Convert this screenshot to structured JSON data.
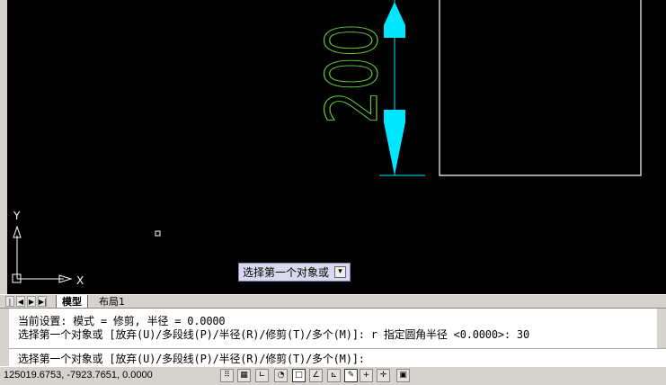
{
  "drawing": {
    "dimension_text": "200",
    "colors": {
      "dimension_text": "#66cc33",
      "arrows": "#00e6ff",
      "rectangle": "#ffffff",
      "ucs": "#ffffff"
    },
    "ucs": {
      "x_label": "X",
      "y_label": "Y"
    }
  },
  "tooltip": {
    "text": "选择第一个对象或",
    "icon": "down-arrow-icon"
  },
  "layout_tabs": {
    "tabs": [
      {
        "label": "模型",
        "active": true
      },
      {
        "label": "布局1",
        "active": false
      }
    ]
  },
  "command": {
    "line1": "当前设置: 模式 = 修剪, 半径 = 0.0000",
    "line2": "选择第一个对象或 [放弃(U)/多段线(P)/半径(R)/修剪(T)/多个(M)]: r 指定圆角半径 <0.0000>: 30",
    "prompt": "选择第一个对象或 [放弃(U)/多段线(P)/半径(R)/修剪(T)/多个(M)]:"
  },
  "status": {
    "coordinates": "125019.6753, -7923.7651, 0.0000"
  }
}
